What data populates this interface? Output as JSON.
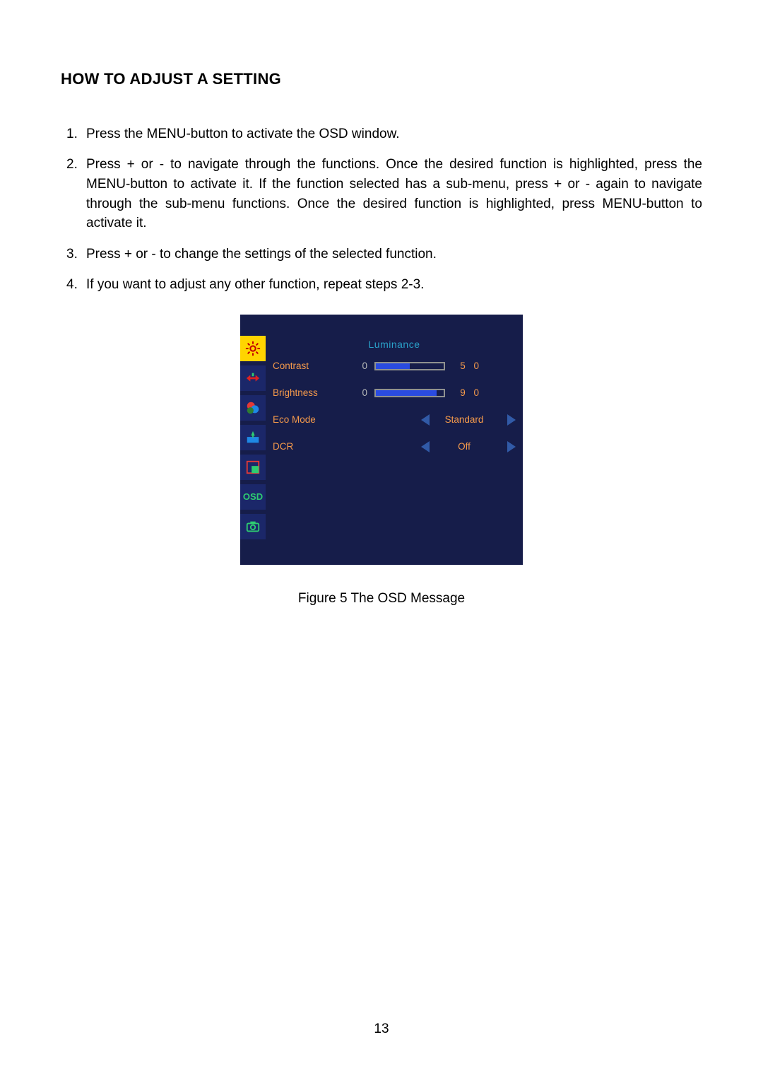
{
  "heading": "HOW TO ADJUST A SETTING",
  "steps": [
    "Press the MENU-button to activate the OSD window.",
    "Press + or - to navigate through the functions. Once the desired function is highlighted, press the MENU-button  to activate it.  If the function selected has a sub-menu, press + or - again to navigate through the sub-menu functions.  Once the desired function is highlighted, press MENU-button to activate it.",
    "Press + or - to change the settings of the selected function.",
    "If you want to adjust any other function, repeat steps 2-3."
  ],
  "figure_caption": "Figure 5    The  OSD  Message",
  "page_number": "13",
  "osd": {
    "section_title": "Luminance",
    "rows": {
      "contrast": {
        "label": "Contrast",
        "min": "0",
        "value": "5 0",
        "fill_percent": 50
      },
      "brightness": {
        "label": "Brightness",
        "min": "0",
        "value": "9 0",
        "fill_percent": 90
      },
      "eco": {
        "label": "Eco Mode",
        "value": "Standard"
      },
      "dcr": {
        "label": "DCR",
        "value": "Off"
      }
    },
    "tabs": [
      {
        "name": "luminance-tab",
        "selected": true
      },
      {
        "name": "image-setup-tab",
        "selected": false
      },
      {
        "name": "color-tab",
        "selected": false
      },
      {
        "name": "picture-boost-tab",
        "selected": false
      },
      {
        "name": "window-tab",
        "selected": false
      },
      {
        "name": "osd-tab",
        "selected": false
      },
      {
        "name": "extra-tab",
        "selected": false
      }
    ]
  }
}
